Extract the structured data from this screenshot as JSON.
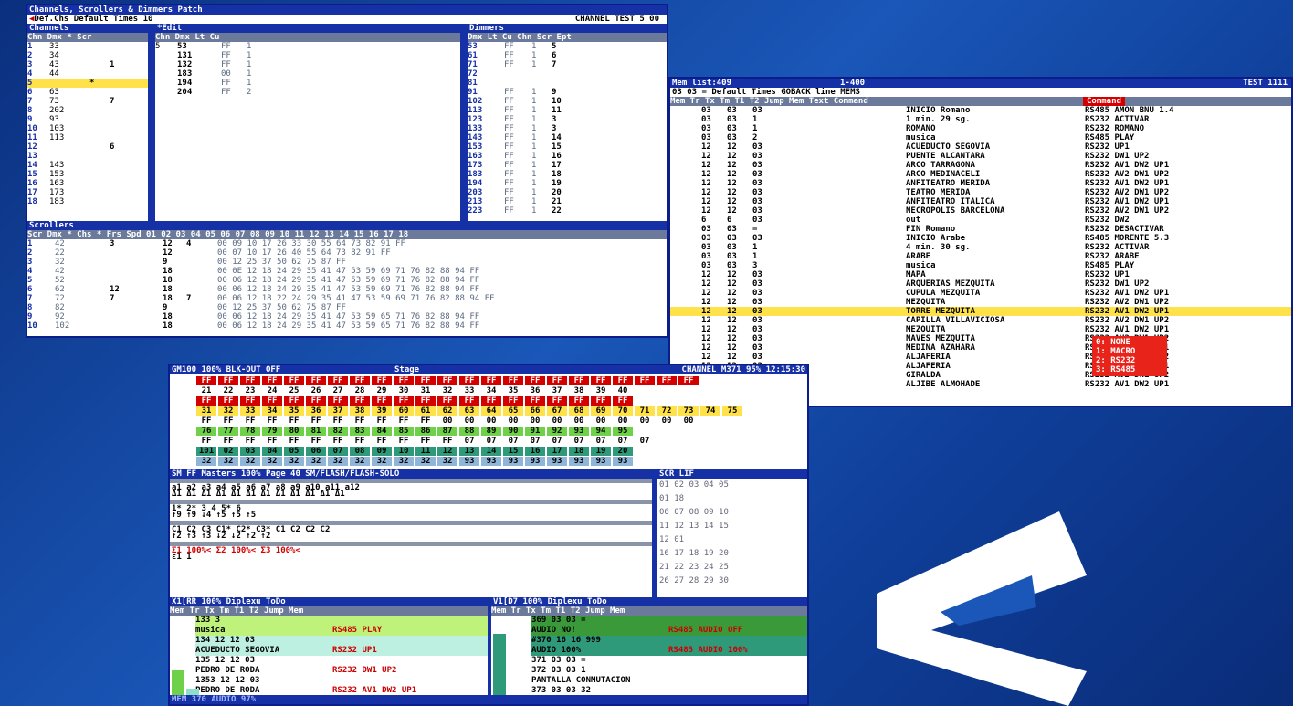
{
  "w1": {
    "title": "Channels, Scrollers & Dimmers Patch",
    "info_left": "Def.Chs  Default Times  10",
    "info_right": "CHANNEL TEST   5  00",
    "channels": {
      "label": "Channels",
      "header": "Chn Dmx  *  Scr",
      "rows": [
        {
          "chn": "1",
          "dmx": "33",
          "mark": "",
          "scr": ""
        },
        {
          "chn": "2",
          "dmx": "34",
          "mark": "",
          "scr": ""
        },
        {
          "chn": "3",
          "dmx": "43",
          "mark": "",
          "scr": "1"
        },
        {
          "chn": "4",
          "dmx": "44",
          "mark": "",
          "scr": ""
        },
        {
          "chn": "5",
          "dmx": "",
          "mark": "*",
          "scr": ""
        },
        {
          "chn": "6",
          "dmx": "63",
          "mark": "",
          "scr": ""
        },
        {
          "chn": "7",
          "dmx": "73",
          "mark": "",
          "scr": "7"
        },
        {
          "chn": "8",
          "dmx": "202",
          "mark": "",
          "scr": ""
        },
        {
          "chn": "9",
          "dmx": "93",
          "mark": "",
          "scr": ""
        },
        {
          "chn": "10",
          "dmx": "103",
          "mark": "",
          "scr": ""
        },
        {
          "chn": "11",
          "dmx": "113",
          "mark": "",
          "scr": ""
        },
        {
          "chn": "12",
          "dmx": "",
          "mark": "",
          "scr": "6"
        },
        {
          "chn": "13",
          "dmx": "",
          "mark": "",
          "scr": ""
        },
        {
          "chn": "14",
          "dmx": "143",
          "mark": "",
          "scr": ""
        },
        {
          "chn": "15",
          "dmx": "153",
          "mark": "",
          "scr": ""
        },
        {
          "chn": "16",
          "dmx": "163",
          "mark": "",
          "scr": ""
        },
        {
          "chn": "17",
          "dmx": "173",
          "mark": "",
          "scr": ""
        },
        {
          "chn": "18",
          "dmx": "183",
          "mark": "",
          "scr": ""
        }
      ]
    },
    "edit": {
      "label": "*Edit",
      "header": "Chn Dmx   Lt  Cu",
      "rows": [
        {
          "chn": "5",
          "dmx": "53",
          "lt": "FF",
          "cu": "1"
        },
        {
          "chn": "",
          "dmx": "131",
          "lt": "FF",
          "cu": "1"
        },
        {
          "chn": "",
          "dmx": "132",
          "lt": "FF",
          "cu": "1"
        },
        {
          "chn": "",
          "dmx": "183",
          "lt": "00",
          "cu": "1"
        },
        {
          "chn": "",
          "dmx": "194",
          "lt": "FF",
          "cu": "1"
        },
        {
          "chn": "",
          "dmx": "204",
          "lt": "FF",
          "cu": "2"
        }
      ]
    },
    "dimmers": {
      "label": "Dimmers",
      "header": "Dmx  Lt  Cu  Chn Scr Ept",
      "rows": [
        {
          "dmx": "53",
          "lt": "FF",
          "cu": "1",
          "chn": "5"
        },
        {
          "dmx": "61",
          "lt": "FF",
          "cu": "1",
          "chn": "6"
        },
        {
          "dmx": "71",
          "lt": "FF",
          "cu": "1",
          "chn": "7"
        },
        {
          "dmx": "72",
          "lt": "",
          "cu": "",
          "chn": ""
        },
        {
          "dmx": "81",
          "lt": "",
          "cu": "",
          "chn": ""
        },
        {
          "dmx": "91",
          "lt": "FF",
          "cu": "1",
          "chn": "9"
        },
        {
          "dmx": "102",
          "lt": "FF",
          "cu": "1",
          "chn": "10"
        },
        {
          "dmx": "113",
          "lt": "FF",
          "cu": "1",
          "chn": "11"
        },
        {
          "dmx": "123",
          "lt": "FF",
          "cu": "1",
          "chn": "3"
        },
        {
          "dmx": "133",
          "lt": "FF",
          "cu": "1",
          "chn": "3"
        },
        {
          "dmx": "143",
          "lt": "FF",
          "cu": "1",
          "chn": "14"
        },
        {
          "dmx": "153",
          "lt": "FF",
          "cu": "1",
          "chn": "15"
        },
        {
          "dmx": "163",
          "lt": "FF",
          "cu": "1",
          "chn": "16"
        },
        {
          "dmx": "173",
          "lt": "FF",
          "cu": "1",
          "chn": "17"
        },
        {
          "dmx": "183",
          "lt": "FF",
          "cu": "1",
          "chn": "18"
        },
        {
          "dmx": "194",
          "lt": "FF",
          "cu": "1",
          "chn": "19"
        },
        {
          "dmx": "203",
          "lt": "FF",
          "cu": "1",
          "chn": "20"
        },
        {
          "dmx": "213",
          "lt": "FF",
          "cu": "1",
          "chn": "21"
        },
        {
          "dmx": "223",
          "lt": "FF",
          "cu": "1",
          "chn": "22"
        }
      ]
    },
    "scrollers": {
      "label": "Scrollers",
      "header": "Scr Dmx  * Chs * Frs Spd  01 02 03 04 05 06 07 08 09 10 11 12 13 14 15 16 17 18",
      "rows": [
        {
          "scr": "1",
          "dmx": "42",
          "chs": "3",
          "frs": "12",
          "spd": "4",
          "vals": "00 09 10 17 26 33 30 55 64 73 82 91 FF"
        },
        {
          "scr": "2",
          "dmx": "22",
          "chs": "",
          "frs": "12",
          "spd": "",
          "vals": "00 07 10 17 26 40 55 64 73 82 91 FF"
        },
        {
          "scr": "3",
          "dmx": "32",
          "chs": "",
          "frs": "9",
          "spd": "",
          "vals": "00 12 25 37 50 62 75 87 FF"
        },
        {
          "scr": "4",
          "dmx": "42",
          "chs": "",
          "frs": "18",
          "spd": "",
          "vals": "00 0E 12 18 24 29 35 41 47 53 59 69 71 76 82 88 94 FF"
        },
        {
          "scr": "5",
          "dmx": "52",
          "chs": "",
          "frs": "18",
          "spd": "",
          "vals": "00 06 12 18 24 29 35 41 47 53 59 69 71 76 82 88 94 FF"
        },
        {
          "scr": "6",
          "dmx": "62",
          "chs": "12",
          "frs": "18",
          "spd": "",
          "vals": "00 06 12 18 24 29 35 41 47 53 59 69 71 76 82 88 94 FF"
        },
        {
          "scr": "7",
          "dmx": "72",
          "chs": "7",
          "frs": "18",
          "spd": "7",
          "vals": "00 06 12 18 22 24 29 35 41 47 53 59 69 71 76 82 88 94 FF"
        },
        {
          "scr": "8",
          "dmx": "82",
          "chs": "",
          "frs": "9",
          "spd": "",
          "vals": "00 12 25 37 50 62 75 87 FF"
        },
        {
          "scr": "9",
          "dmx": "92",
          "chs": "",
          "frs": "18",
          "spd": "",
          "vals": "00 06 12 18 24 29 35 41 47 53 59 65 71 76 82 88 94 FF"
        },
        {
          "scr": "10",
          "dmx": "102",
          "chs": "",
          "frs": "18",
          "spd": "",
          "vals": "00 06 12 18 24 29 35 41 47 53 59 65 71 76 82 88 94 FF"
        }
      ]
    }
  },
  "w2": {
    "title_left": "Mem list:409",
    "title_mid": "1-400",
    "title_right": "TEST 1111",
    "info": "03  03  =   Default Times       GOBACK line MEMS",
    "command_label": "Command",
    "header": "Mem   Tr  Tx  Tm  T1  T2  Jump Mem  Text                     Command",
    "rows": [
      {
        "a": "03",
        "b": "03",
        "c": "03",
        "text": "INICIO Romano",
        "cmd": "RS485 AMON BNU 1.4"
      },
      {
        "a": "03",
        "b": "03",
        "c": "1",
        "text": "1 min. 29 sg.",
        "cmd": "RS232 ACTIVAR"
      },
      {
        "a": "03",
        "b": "03",
        "c": "1",
        "text": "ROMANO",
        "cmd": "RS232 ROMANO"
      },
      {
        "a": "03",
        "b": "03",
        "c": "2",
        "text": "musica",
        "cmd": "RS485 PLAY"
      },
      {
        "a": "12",
        "b": "12",
        "c": "03",
        "text": "ACUEDUCTO SEGOVIA",
        "cmd": "RS232 UP1"
      },
      {
        "a": "12",
        "b": "12",
        "c": "03",
        "text": "PUENTE ALCANTARA",
        "cmd": "RS232 DW1 UP2"
      },
      {
        "a": "12",
        "b": "12",
        "c": "03",
        "text": "ARCO TARRAGONA",
        "cmd": "RS232 AV1 DW2 UP1"
      },
      {
        "a": "12",
        "b": "12",
        "c": "03",
        "text": "ARCO MEDINACELI",
        "cmd": "RS232 AV2 DW1 UP2"
      },
      {
        "a": "12",
        "b": "12",
        "c": "03",
        "text": "ANFITEATRO MERIDA",
        "cmd": "RS232 AV1 DW2 UP1"
      },
      {
        "a": "12",
        "b": "12",
        "c": "03",
        "text": "TEATRO MERIDA",
        "cmd": "RS232 AV2 DW1 UP2"
      },
      {
        "a": "12",
        "b": "12",
        "c": "03",
        "text": "ANFITEATRO ITALICA",
        "cmd": "RS232 AV1 DW2 UP1"
      },
      {
        "a": "12",
        "b": "12",
        "c": "03",
        "text": "NECROPOLIS BARCELONA",
        "cmd": "RS232 AV2 DW1 UP2"
      },
      {
        "a": "6",
        "b": "6",
        "c": "03",
        "text": "out",
        "cmd": "RS232 DW2"
      },
      {
        "a": "03",
        "b": "03",
        "c": "=",
        "text": "FIN Romano",
        "cmd": "RS232 DESACTIVAR"
      },
      {
        "a": "03",
        "b": "03",
        "c": "03",
        "text": "INICIO Arabe",
        "cmd": "RS485 MORENTE  5.3"
      },
      {
        "a": "03",
        "b": "03",
        "c": "1",
        "text": "4 min. 30 sg.",
        "cmd": "RS232 ACTIVAR"
      },
      {
        "a": "03",
        "b": "03",
        "c": "1",
        "text": "ARABE",
        "cmd": "RS232 ARABE"
      },
      {
        "a": "03",
        "b": "03",
        "c": "3",
        "text": "musica",
        "cmd": "RS485 PLAY"
      },
      {
        "a": "12",
        "b": "12",
        "c": "03",
        "text": "MAPA",
        "cmd": "RS232 UP1"
      },
      {
        "a": "12",
        "b": "12",
        "c": "03",
        "text": "ARQUERIAS MEZQUITA",
        "cmd": "RS232 DW1 UP2"
      },
      {
        "a": "12",
        "b": "12",
        "c": "03",
        "text": "CUPULA MEZQUITA",
        "cmd": "RS232 AV1 DW2 UP1"
      },
      {
        "a": "12",
        "b": "12",
        "c": "03",
        "text": "MEZQUITA",
        "cmd": "RS232 AV2 DW1 UP2"
      },
      {
        "a": "12",
        "b": "12",
        "c": "03",
        "text": "TORRE MEZQUITA",
        "cmd": "RS232 AV1 DW2 UP1"
      },
      {
        "a": "12",
        "b": "12",
        "c": "03",
        "text": "CAPILLA VILLAVICIOSA",
        "cmd": "RS232 AV2 DW1 UP2"
      },
      {
        "a": "12",
        "b": "12",
        "c": "03",
        "text": "MEZQUITA",
        "cmd": "RS232 AV1 DW2 UP1"
      },
      {
        "a": "12",
        "b": "12",
        "c": "03",
        "text": "NAVES MEZQUITA",
        "cmd": "RS232 AV2 DW1 UP2"
      },
      {
        "a": "12",
        "b": "12",
        "c": "03",
        "text": "MEDINA AZAHARA",
        "cmd": "RS232 AV1 DW2 UP1"
      },
      {
        "a": "12",
        "b": "12",
        "c": "03",
        "text": "ALJAFERIA",
        "cmd": "RS232 AV2 DW1 UP2"
      },
      {
        "a": "12",
        "b": "12",
        "c": "03",
        "text": "ALJAFERIA",
        "cmd": "RS232 AV1 DW2 UP1"
      },
      {
        "a": "12",
        "b": "12",
        "c": "03",
        "text": "GIRALDA",
        "cmd": "RS232 AV2 DW1 UP2"
      },
      {
        "a": "12",
        "b": "12",
        "c": "03",
        "text": "ALJIBE ALMOHADE",
        "cmd": "RS232 AV1 DW2 UP1"
      }
    ],
    "popup": [
      "0: NONE",
      "1: MACRO",
      "2: RS232",
      "3: RS485"
    ]
  },
  "w3": {
    "title_left": "GM100 100% BLK-OUT OFF",
    "title_mid": "Stage",
    "title_right": "CHANNEL  M371    95%  12:15:30",
    "stage_rows": [
      "FF FF FF FF FF FF FF FF FF FF FF FF FF FF FF FF FF FF FF FF FF FF FF",
      "21 22 23 24 25 26 27 28 29 30 31 32 33 34 35 36 37 38 39 40",
      "FF FF FF FF FF FF FF FF FF FF FF FF FF FF FF FF FF FF FF FF",
      "31 32 33 34 35 36 37 38 39 60 61 62 63 64 65 66 67 68 69 70 71 72 73 74 75",
      "FF FF FF FF FF FF FF FF FF FF FF 00 00 00 00 00 00 00 00 00 00 00 00",
      "76 77 78 79 80 81 82 83 84 85 86 87 88 89 90 91 92 93 94 95",
      "FF FF FF FF FF FF FF FF FF FF FF FF 07 07 07 07 07 07 07 07 07",
      "101 02 03 04 05 06 07 08 09 10 11 12 13 14 15 16 17 18 19 20",
      "32 32 32 32 32 32 32 32 32 32 32 32 93 93 93 93 93 93 93 93"
    ],
    "masters_title": "SM FF Masters  100% Page 40  SM/FLASH/FLASH-SOLO",
    "scr_title": "SCR   LIF",
    "masters_rows": [
      "a1   a2   a3   a4   a5   a6   a7   a8   a9   a10  a11  a12",
      "Δ1   Δ1   Δ1   Δ1   Δ1   Δ1   Δ1   Δ1   Δ1   Δ1   Δ1   Δ1",
      "1*   2*   3    4    5*   6",
      "↑9   ↑9   ↓4   ↑5   ↑5   ↑5",
      "C1   C2   C3        C1*  C2*  C3*       C1   C2   C2   C2",
      "↑2   ↑3   ↑3                           ↓2   ↓2   ↑2   ↑2",
      "Σ1 100%<               Σ2 100%<              Σ3 100%<",
      "  ε1                       1"
    ],
    "scr_rows": [
      "01  02  03  04  05",
      "01    18",
      "06  07  08  09  10",
      "11  12  13  14  15",
      "  12  01",
      "16  17  18  19  20",
      "21  22  23  24  25",
      "26  27  28  29  30"
    ],
    "x_title": "X1[RR  100% Diplexu ToDo",
    "x_header": "Mem  Tr   Tx  Tm  T1  T2   Jump Mem",
    "x_rows": [
      {
        "t": "133           3",
        "c": ""
      },
      {
        "t": "musica",
        "c": "RS485 PLAY"
      },
      {
        "t": "134  12  12  03",
        "c": ""
      },
      {
        "t": "ACUEDUCTO SEGOVIA",
        "c": "RS232 UP1"
      },
      {
        "t": "135  12  12  03",
        "c": ""
      },
      {
        "t": "PEDRO DE RODA",
        "c": "RS232 DW1 UP2"
      },
      {
        "t": "1353 12  12  03",
        "c": ""
      },
      {
        "t": "PEDRO DE RODA",
        "c": "RS232 AV1 DW2 UP1"
      }
    ],
    "v_title": "V1[D7  100% Diplexu ToDo",
    "v_header": "Mem  Tr   Tx  Tm  T1  T2   Jump Mem",
    "v_rows": [
      {
        "t": "369  03  03  =",
        "c": ""
      },
      {
        "t": "AUDIO NO!",
        "c": "RS485 AUDIO OFF"
      },
      {
        "t": "#370  16  16  999",
        "c": ""
      },
      {
        "t": "AUDIO 100%",
        "c": "RS485 AUDIO 100%"
      },
      {
        "t": "371  03  03  =",
        "c": ""
      },
      {
        "t": "372  03  03  1",
        "c": ""
      },
      {
        "t": "PANTALLA CONMUTACION",
        "c": ""
      },
      {
        "t": "373  03  03  32",
        "c": ""
      }
    ],
    "footer": "MEM  370 AUDIO 97%"
  },
  "colors": {
    "accent": "#1630a5",
    "highlight": "#ffe24a",
    "alert": "#d40000",
    "green": "#6fd14a",
    "teal": "#2f9a7a"
  }
}
